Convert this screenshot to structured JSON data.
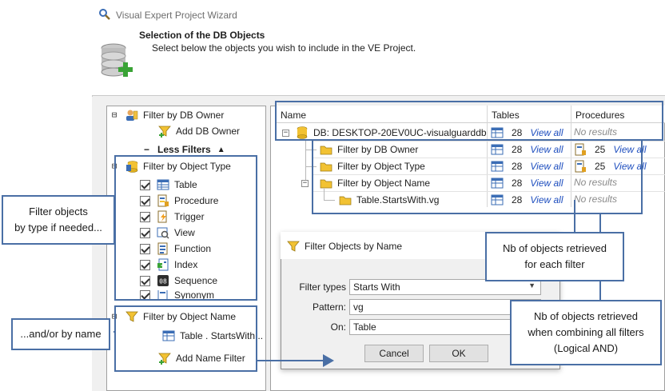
{
  "window": {
    "title": "Visual Expert Project Wizard",
    "header_title": "Selection of the DB Objects",
    "header_subtitle": "Select below the objects you wish to include in the VE Project."
  },
  "tree": {
    "db_owner": {
      "expander": "⊟",
      "label": "Filter by DB Owner"
    },
    "add_db_owner": "Add DB Owner",
    "less_filters": {
      "prefix": "−",
      "label": "Less Filters",
      "arrow": "▲"
    },
    "object_type": {
      "expander": "⊟",
      "label": "Filter by Object Type"
    },
    "object_types": [
      "Table",
      "Procedure",
      "Trigger",
      "View",
      "Function",
      "Index",
      "Sequence",
      "Synonym"
    ],
    "object_name": {
      "expander": "⊟",
      "label": "Filter by Object Name"
    },
    "name_filter_item": "Table . StartsWith...",
    "add_name_filter": "Add Name Filter"
  },
  "grid": {
    "columns": [
      "Name",
      "Tables",
      "Procedures"
    ],
    "rows": [
      {
        "name": "DB: DESKTOP-20EV0UC-visualguarddb",
        "tables": "28",
        "tables_link": "View all",
        "procedures": "No results",
        "procedures_link": ""
      },
      {
        "name": "Filter by DB Owner",
        "tables": "28",
        "tables_link": "View all",
        "procedures": "25",
        "procedures_link": "View all"
      },
      {
        "name": "Filter by Object Type",
        "tables": "28",
        "tables_link": "View all",
        "procedures": "25",
        "procedures_link": "View all"
      },
      {
        "name": "Filter by Object Name",
        "tables": "28",
        "tables_link": "View all",
        "procedures": "No results",
        "procedures_link": ""
      },
      {
        "name": "Table.StartsWith.vg",
        "tables": "28",
        "tables_link": "View all",
        "procedures": "No results",
        "procedures_link": ""
      }
    ]
  },
  "dialog": {
    "title": "Filter Objects by Name",
    "filter_types_label": "Filter types",
    "filter_types_value": "Starts With",
    "pattern_label": "Pattern:",
    "pattern_value": "vg",
    "on_label": "On:",
    "on_value": "Table",
    "cancel_label": "Cancel",
    "ok_label": "OK"
  },
  "callouts": {
    "filter_type": "Filter objects\nby type if needed...",
    "by_name": "...and/or by name",
    "each_filter": "Nb of objects retrieved\nfor each filter",
    "combining": "Nb of objects retrieved\nwhen combining all filters\n(Logical AND)"
  },
  "colors": {
    "highlight_border": "#4a6fa5",
    "link": "#1f4fbf",
    "no_results": "#8a8a8a"
  }
}
